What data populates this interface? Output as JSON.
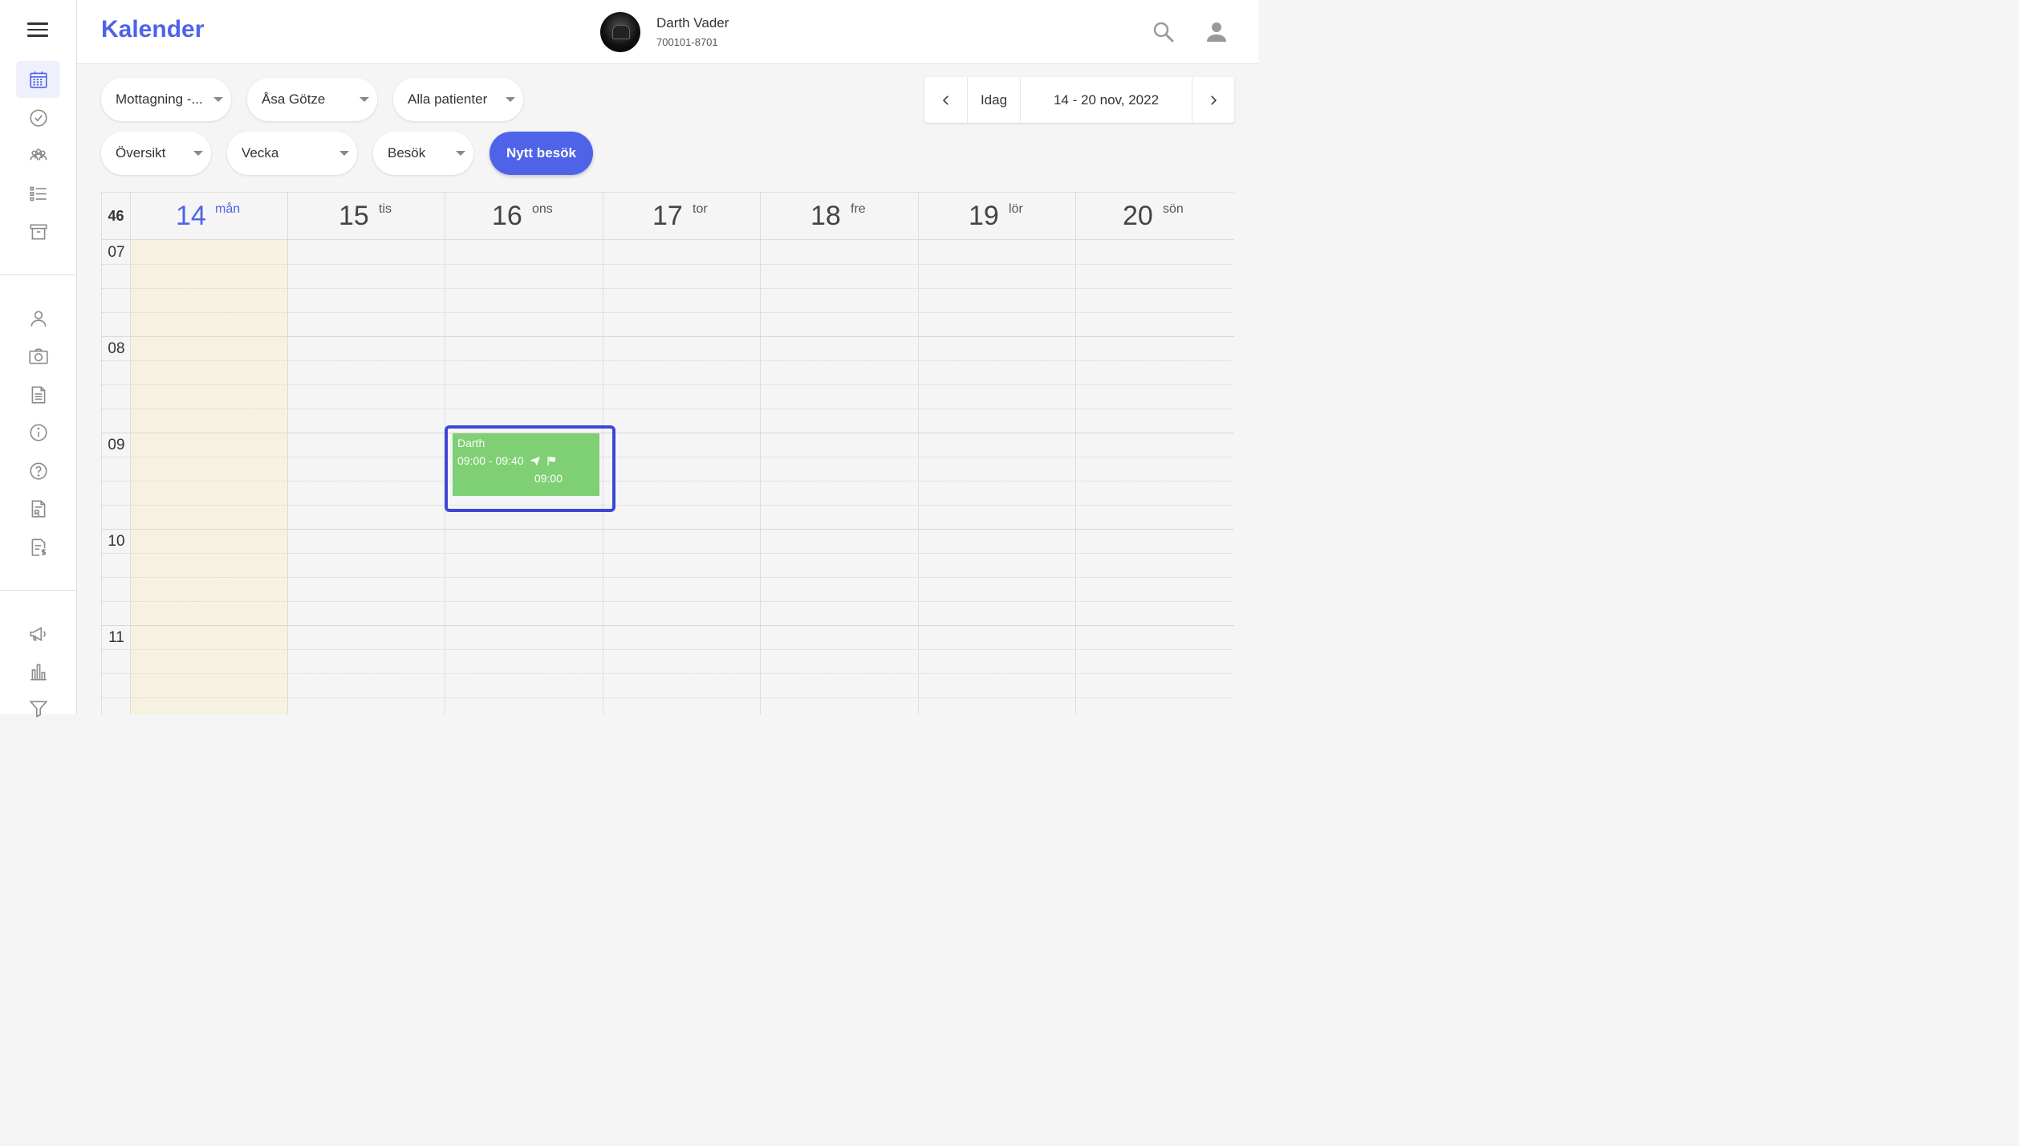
{
  "header": {
    "title": "Kalender",
    "patient_name": "Darth Vader",
    "patient_id": "700101-8701"
  },
  "filters": {
    "clinic": "Mottagning -...",
    "staff": "Åsa Götze",
    "patients": "Alla patienter",
    "view": "Översikt",
    "period": "Vecka",
    "type": "Besök",
    "new_visit": "Nytt besök"
  },
  "date_nav": {
    "today_label": "Idag",
    "range": "14 - 20 nov, 2022"
  },
  "calendar": {
    "week_number": "46",
    "days": [
      {
        "num": "14",
        "weekday": "mån",
        "today": true
      },
      {
        "num": "15",
        "weekday": "tis"
      },
      {
        "num": "16",
        "weekday": "ons"
      },
      {
        "num": "17",
        "weekday": "tor"
      },
      {
        "num": "18",
        "weekday": "fre"
      },
      {
        "num": "19",
        "weekday": "lör"
      },
      {
        "num": "20",
        "weekday": "sön"
      }
    ],
    "hours": [
      "07",
      "08",
      "09",
      "10",
      "11"
    ],
    "event": {
      "name": "Darth",
      "time": "09:00 - 09:40",
      "start": "09:00",
      "color": "#7fcf74"
    }
  },
  "colors": {
    "accent": "#4f63e8",
    "today_column": "#f7f2df",
    "event_outline": "#3d47d6"
  }
}
